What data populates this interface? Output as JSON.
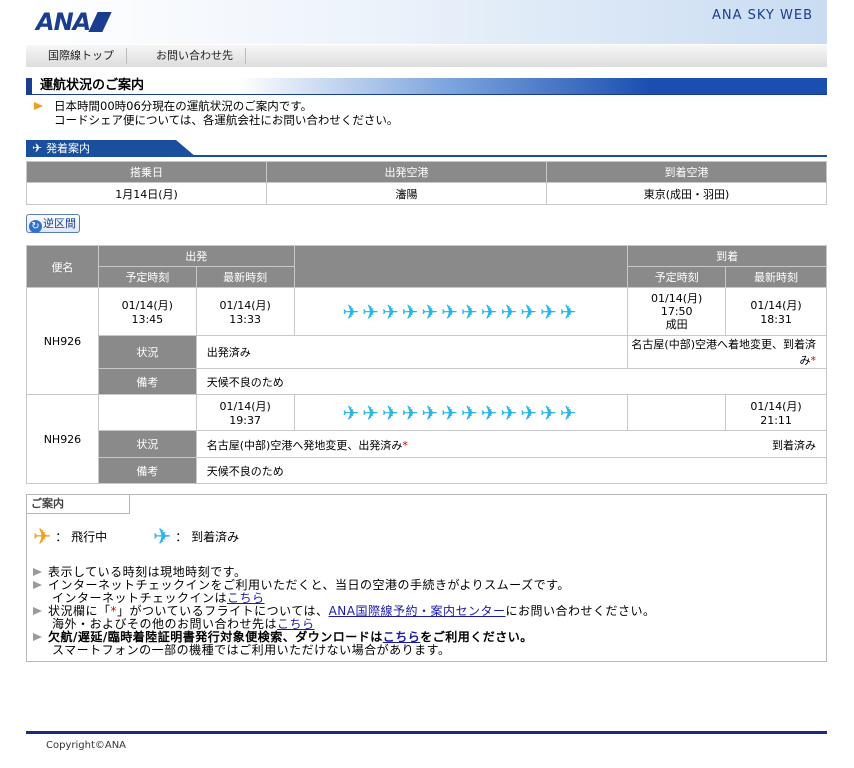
{
  "header": {
    "logo": "ANA",
    "site_name": "ANA SKY WEB"
  },
  "nav": {
    "items": [
      "国際線トップ",
      "お問い合わせ先"
    ]
  },
  "section": {
    "title": "運航状況のご案内"
  },
  "intro": {
    "line1": "日本時間00時06分現在の運航状況のご案内です。",
    "line2": "コードシェア便については、各運航会社にお問い合わせください。"
  },
  "subsection": {
    "title": "発着案内"
  },
  "route": {
    "headers": [
      "搭乗日",
      "出発空港",
      "到着空港"
    ],
    "date": "1月14日(月)",
    "departure": "瀋陽",
    "arrival": "東京(成田・羽田)"
  },
  "swap_button": "逆区間",
  "flights_table": {
    "col_flight": "便名",
    "col_departure": "出発",
    "col_arrival": "到着",
    "col_scheduled": "予定時刻",
    "col_latest": "最新時刻",
    "label_status": "状況",
    "label_remarks": "備考"
  },
  "flights": [
    {
      "flight_no": "NH926",
      "dep_scheduled_date": "01/14(月)",
      "dep_scheduled_time": "13:45",
      "dep_latest_date": "01/14(月)",
      "dep_latest_time": "13:33",
      "arr_scheduled_date": "01/14(月)",
      "arr_scheduled_time": "17:50",
      "arr_scheduled_airport": "成田",
      "arr_latest_date": "01/14(月)",
      "arr_latest_time": "18:31",
      "status_dep": "出発済み",
      "status_arr": "名古屋(中部)空港へ着地変更、到着済み",
      "status_arr_star": "*",
      "remarks": "天候不良のため"
    },
    {
      "flight_no": "NH926",
      "dep_latest_date": "01/14(月)",
      "dep_latest_time": "19:37",
      "arr_latest_date": "01/14(月)",
      "arr_latest_time": "21:11",
      "status_dep": "名古屋(中部)空港へ発地変更、出発済み",
      "status_dep_star": "*",
      "status_arr": "到着済み",
      "remarks": "天候不良のため"
    }
  ],
  "plane_icon": "airplane-icon",
  "colors": {
    "in_flight": "#f0a020",
    "arrived": "#28b6e8",
    "brand": "#1a3d8f"
  },
  "info": {
    "title": "ご案内",
    "legend_in_flight": "飛行中",
    "legend_arrived": "到着済み",
    "legend_sep": "：",
    "note1": "表示している時刻は現地時刻です。",
    "note2a": "インターネットチェックインをご利用いただくと、当日の空港の手続きがよりスムーズです。",
    "note2b_prefix": "インターネットチェックインは",
    "note2b_link": "こちら",
    "note3_prefix": "状況欄に「",
    "note3_star": "*",
    "note3_mid": "」がついているフライトについては、",
    "note3_link": "ANA国際線予約・案内センター",
    "note3_suffix": "にお問い合わせください。",
    "note3b_prefix": "海外・およびその他のお問い合わせ先は",
    "note3b_link": "こちら",
    "note4_bold": "欠航/遅延/臨時着陸証明書発行対象便検索、ダウンロードは",
    "note4_link": "こちら",
    "note4_suffix": "をご利用ください。",
    "note4b": "スマートフォンの一部の機種ではご利用いただけない場合があります。"
  },
  "footer": {
    "copyright": "Copyright©ANA"
  }
}
